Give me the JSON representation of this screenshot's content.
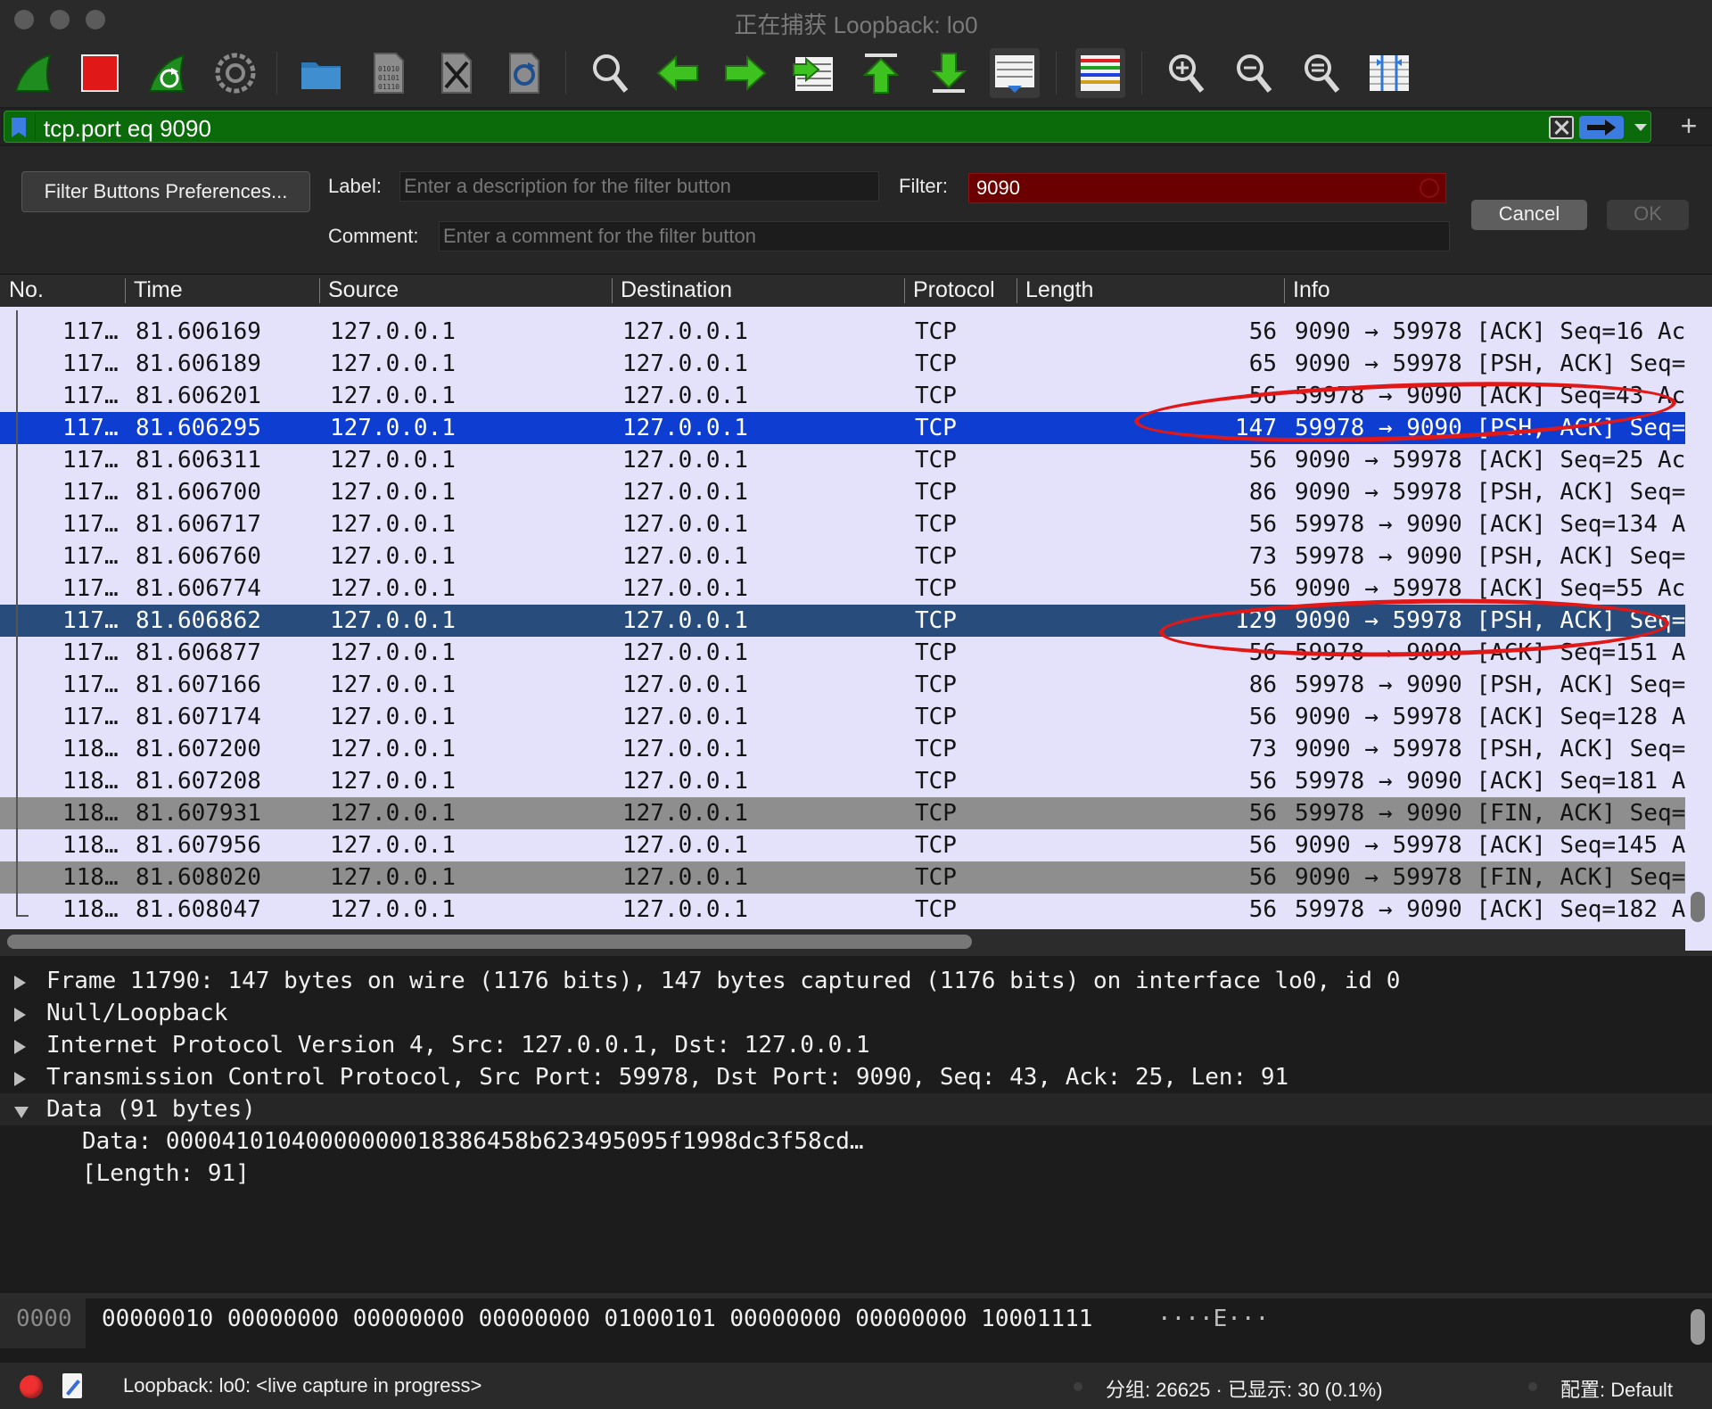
{
  "window": {
    "title": "正在捕获 Loopback: lo0"
  },
  "toolbar": {
    "icons": [
      "shark-fin-start-icon",
      "stop-capture-icon",
      "restart-capture-icon",
      "capture-options-icon",
      "open-file-icon",
      "save-file-icon",
      "close-file-icon",
      "reload-file-icon",
      "find-packet-icon",
      "go-back-icon",
      "go-forward-icon",
      "go-to-packet-icon",
      "go-first-packet-icon",
      "go-last-packet-icon",
      "auto-scroll-icon",
      "colorize-icon",
      "zoom-in-icon",
      "zoom-out-icon",
      "zoom-normal-icon",
      "resize-columns-icon"
    ]
  },
  "display_filter": {
    "value": "tcp.port eq 9090"
  },
  "filter_prefs": {
    "button_label": "Filter Buttons Preferences...",
    "label_caption": "Label:",
    "label_placeholder": "Enter a description for the filter button",
    "filter_caption": "Filter:",
    "filter_value": "9090",
    "comment_caption": "Comment:",
    "comment_placeholder": "Enter a comment for the filter button",
    "cancel_label": "Cancel",
    "ok_label": "OK"
  },
  "packet_list": {
    "columns": [
      "No.",
      "Time",
      "Source",
      "Destination",
      "Protocol",
      "Length",
      "Info"
    ],
    "rows": [
      {
        "no": "117…",
        "time": "81.606169",
        "src": "127.0.0.1",
        "dst": "127.0.0.1",
        "proto": "TCP",
        "len": "56",
        "info": "9090 → 59978 [ACK] Seq=16 Ac",
        "style": "normal"
      },
      {
        "no": "117…",
        "time": "81.606189",
        "src": "127.0.0.1",
        "dst": "127.0.0.1",
        "proto": "TCP",
        "len": "65",
        "info": "9090 → 59978 [PSH, ACK] Seq=",
        "style": "normal"
      },
      {
        "no": "117…",
        "time": "81.606201",
        "src": "127.0.0.1",
        "dst": "127.0.0.1",
        "proto": "TCP",
        "len": "56",
        "info": "59978 → 9090 [ACK] Seq=43 Ac",
        "style": "normal"
      },
      {
        "no": "117…",
        "time": "81.606295",
        "src": "127.0.0.1",
        "dst": "127.0.0.1",
        "proto": "TCP",
        "len": "147",
        "info": "59978 → 9090 [PSH, ACK] Seq=",
        "style": "sel"
      },
      {
        "no": "117…",
        "time": "81.606311",
        "src": "127.0.0.1",
        "dst": "127.0.0.1",
        "proto": "TCP",
        "len": "56",
        "info": "9090 → 59978 [ACK] Seq=25 Ac",
        "style": "normal"
      },
      {
        "no": "117…",
        "time": "81.606700",
        "src": "127.0.0.1",
        "dst": "127.0.0.1",
        "proto": "TCP",
        "len": "86",
        "info": "9090 → 59978 [PSH, ACK] Seq=",
        "style": "normal"
      },
      {
        "no": "117…",
        "time": "81.606717",
        "src": "127.0.0.1",
        "dst": "127.0.0.1",
        "proto": "TCP",
        "len": "56",
        "info": "59978 → 9090 [ACK] Seq=134 A",
        "style": "normal"
      },
      {
        "no": "117…",
        "time": "81.606760",
        "src": "127.0.0.1",
        "dst": "127.0.0.1",
        "proto": "TCP",
        "len": "73",
        "info": "59978 → 9090 [PSH, ACK] Seq=",
        "style": "normal"
      },
      {
        "no": "117…",
        "time": "81.606774",
        "src": "127.0.0.1",
        "dst": "127.0.0.1",
        "proto": "TCP",
        "len": "56",
        "info": "9090 → 59978 [ACK] Seq=55 Ac",
        "style": "normal"
      },
      {
        "no": "117…",
        "time": "81.606862",
        "src": "127.0.0.1",
        "dst": "127.0.0.1",
        "proto": "TCP",
        "len": "129",
        "info": "9090 → 59978 [PSH, ACK] Seq=",
        "style": "sel2"
      },
      {
        "no": "117…",
        "time": "81.606877",
        "src": "127.0.0.1",
        "dst": "127.0.0.1",
        "proto": "TCP",
        "len": "56",
        "info": "59978 → 9090 [ACK] Seq=151 A",
        "style": "normal"
      },
      {
        "no": "117…",
        "time": "81.607166",
        "src": "127.0.0.1",
        "dst": "127.0.0.1",
        "proto": "TCP",
        "len": "86",
        "info": "59978 → 9090 [PSH, ACK] Seq=",
        "style": "normal"
      },
      {
        "no": "117…",
        "time": "81.607174",
        "src": "127.0.0.1",
        "dst": "127.0.0.1",
        "proto": "TCP",
        "len": "56",
        "info": "9090 → 59978 [ACK] Seq=128 A",
        "style": "normal"
      },
      {
        "no": "118…",
        "time": "81.607200",
        "src": "127.0.0.1",
        "dst": "127.0.0.1",
        "proto": "TCP",
        "len": "73",
        "info": "9090 → 59978 [PSH, ACK] Seq=",
        "style": "normal"
      },
      {
        "no": "118…",
        "time": "81.607208",
        "src": "127.0.0.1",
        "dst": "127.0.0.1",
        "proto": "TCP",
        "len": "56",
        "info": "59978 → 9090 [ACK] Seq=181 A",
        "style": "normal"
      },
      {
        "no": "118…",
        "time": "81.607931",
        "src": "127.0.0.1",
        "dst": "127.0.0.1",
        "proto": "TCP",
        "len": "56",
        "info": "59978 → 9090 [FIN, ACK] Seq=",
        "style": "fin"
      },
      {
        "no": "118…",
        "time": "81.607956",
        "src": "127.0.0.1",
        "dst": "127.0.0.1",
        "proto": "TCP",
        "len": "56",
        "info": "9090 → 59978 [ACK] Seq=145 A",
        "style": "normal"
      },
      {
        "no": "118…",
        "time": "81.608020",
        "src": "127.0.0.1",
        "dst": "127.0.0.1",
        "proto": "TCP",
        "len": "56",
        "info": "9090 → 59978 [FIN, ACK] Seq=",
        "style": "fin"
      },
      {
        "no": "118…",
        "time": "81.608047",
        "src": "127.0.0.1",
        "dst": "127.0.0.1",
        "proto": "TCP",
        "len": "56",
        "info": "59978 → 9090 [ACK] Seq=182 A",
        "style": "normal"
      }
    ]
  },
  "details": {
    "rows": [
      {
        "text": "Frame 11790: 147 bytes on wire (1176 bits), 147 bytes captured (1176 bits) on interface lo0, id 0",
        "state": "collapsed"
      },
      {
        "text": "Null/Loopback",
        "state": "collapsed"
      },
      {
        "text": "Internet Protocol Version 4, Src: 127.0.0.1, Dst: 127.0.0.1",
        "state": "collapsed"
      },
      {
        "text": "Transmission Control Protocol, Src Port: 59978, Dst Port: 9090, Seq: 43, Ack: 25, Len: 91",
        "state": "collapsed"
      },
      {
        "text": "Data (91 bytes)",
        "state": "expanded"
      },
      {
        "text": "Data: 00004101040000000018386458b623495095f1998dc3f58cd…",
        "state": "child"
      },
      {
        "text": "[Length: 91]",
        "state": "child"
      }
    ]
  },
  "bytes": {
    "offset": "0000",
    "hex": "00000010 00000000 00000000 00000000 01000101 00000000 00000000 10001111",
    "ascii": "····E···"
  },
  "status": {
    "capture_text": "Loopback: lo0: <live capture in progress>",
    "packets_text": "分组: 26625 · 已显示: 30 (0.1%)",
    "profile_text": "配置:  Default"
  }
}
